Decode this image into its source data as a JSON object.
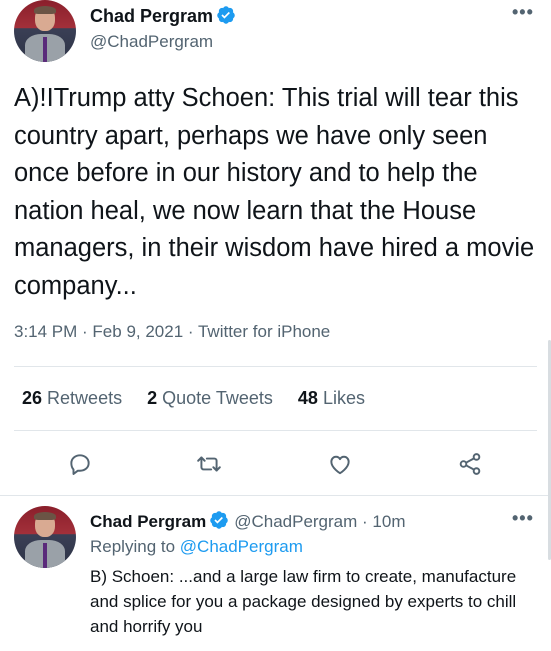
{
  "tweet": {
    "author_name": "Chad Pergram",
    "author_handle": "@ChadPergram",
    "text": "A)!ITrump atty Schoen: This trial will tear this country apart, perhaps we have only seen once before in our history and to help the nation heal, we now learn that the House managers, in their wisdom have hired a movie company...",
    "time": "3:14 PM",
    "separator": " · ",
    "date": "Feb 9, 2021",
    "source": "Twitter for iPhone",
    "more_icon": "more-icon"
  },
  "stats": {
    "retweets_count": "26",
    "retweets_label": "Retweets",
    "quote_count": "2",
    "quote_label": "Quote Tweets",
    "likes_count": "48",
    "likes_label": "Likes"
  },
  "actions": [
    {
      "icon": "reply-icon"
    },
    {
      "icon": "retweet-icon"
    },
    {
      "icon": "like-icon"
    },
    {
      "icon": "share-icon"
    }
  ],
  "reply": {
    "author_name": "Chad Pergram",
    "author_handle": "@ChadPergram",
    "separator": " · ",
    "time_ago": "10m",
    "replying_prefix": "Replying to ",
    "replying_to": "@ChadPergram",
    "text": "B) Schoen: ...and a large law firm to create, manufacture and splice for you a package designed by experts to chill and horrify you"
  },
  "colors": {
    "text": "#0f1419",
    "secondary": "#536471",
    "accent": "#1d9bf0",
    "verified": "#1d9bf0"
  }
}
